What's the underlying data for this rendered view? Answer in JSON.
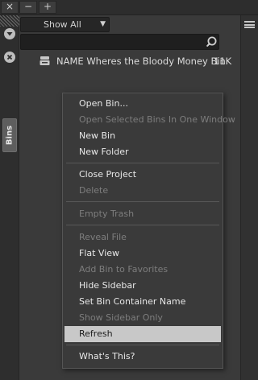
{
  "window": {
    "tab_buttons": [
      {
        "label": "×"
      },
      {
        "label": "−"
      },
      {
        "label": "+"
      }
    ]
  },
  "left_panel": {
    "tab_label": "Bins"
  },
  "toolbar": {
    "show_filter": "Show All",
    "search_value": ""
  },
  "bin_list": {
    "items": [
      {
        "name": "NAME Wheres the Bloody Money Bin",
        "size": "11K"
      }
    ]
  },
  "context_menu": {
    "items": [
      {
        "label": "Open Bin...",
        "enabled": true
      },
      {
        "label": "Open Selected Bins In One Window",
        "enabled": false
      },
      {
        "label": "New Bin",
        "enabled": true
      },
      {
        "label": "New Folder",
        "enabled": true
      },
      {
        "label": "Close Project",
        "enabled": true
      },
      {
        "label": "Delete",
        "enabled": false
      },
      {
        "label": "Empty Trash",
        "enabled": false
      },
      {
        "label": "Reveal File",
        "enabled": false
      },
      {
        "label": "Flat View",
        "enabled": true
      },
      {
        "label": "Add Bin to Favorites",
        "enabled": false
      },
      {
        "label": "Hide Sidebar",
        "enabled": true
      },
      {
        "label": "Set Bin Container Name",
        "enabled": true
      },
      {
        "label": "Show Sidebar Only",
        "enabled": false
      },
      {
        "label": "Refresh",
        "enabled": true,
        "highlighted": true
      },
      {
        "label": "What's This?",
        "enabled": true
      }
    ]
  },
  "icons": {
    "filter": "filter-funnel-icon",
    "close": "close-circle-icon",
    "panel_menu": "hamburger-menu-icon",
    "search": "search-icon",
    "bin": "bin-icon"
  },
  "colors": {
    "highlight": "#c8c8c8",
    "background": "#3a3a3a"
  }
}
